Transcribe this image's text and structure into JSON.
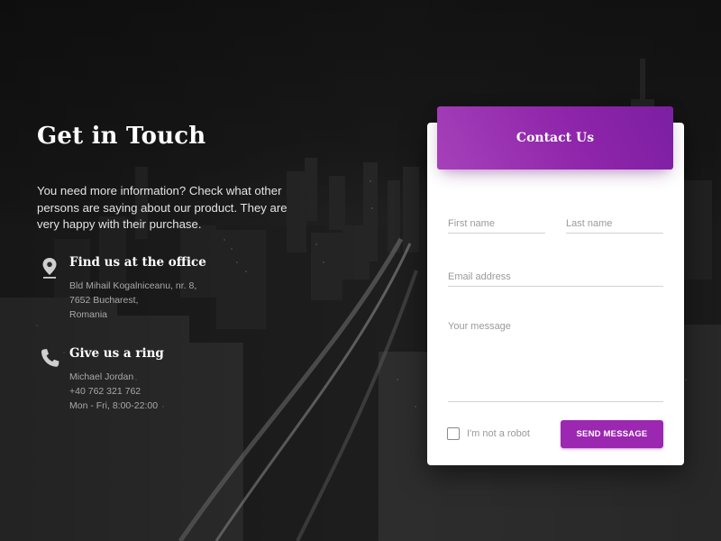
{
  "info": {
    "title": "Get in Touch",
    "description": "You need more information? Check what other persons are saying about our product. They are very happy with their purchase.",
    "office": {
      "icon": "location-pin-icon",
      "heading": "Find us at the office",
      "lines": [
        "Bld Mihail Kogalniceanu, nr. 8,",
        "7652 Bucharest,",
        "Romania"
      ]
    },
    "phone": {
      "icon": "phone-icon",
      "heading": "Give us a ring",
      "lines": [
        "Michael Jordan",
        "+40 762 321 762",
        "Mon - Fri, 8:00-22:00"
      ]
    }
  },
  "form": {
    "header": "Contact Us",
    "first_name": {
      "placeholder": "First name",
      "value": ""
    },
    "last_name": {
      "placeholder": "Last name",
      "value": ""
    },
    "email": {
      "placeholder": "Email address",
      "value": ""
    },
    "message": {
      "placeholder": "Your message",
      "value": ""
    },
    "robot_label": "I'm not a robot",
    "robot_checked": false,
    "send_label": "SEND MESSAGE"
  },
  "colors": {
    "accent": "#9c27b0",
    "header_gradient_start": "#a641b9",
    "header_gradient_end": "#7b1fa2"
  }
}
